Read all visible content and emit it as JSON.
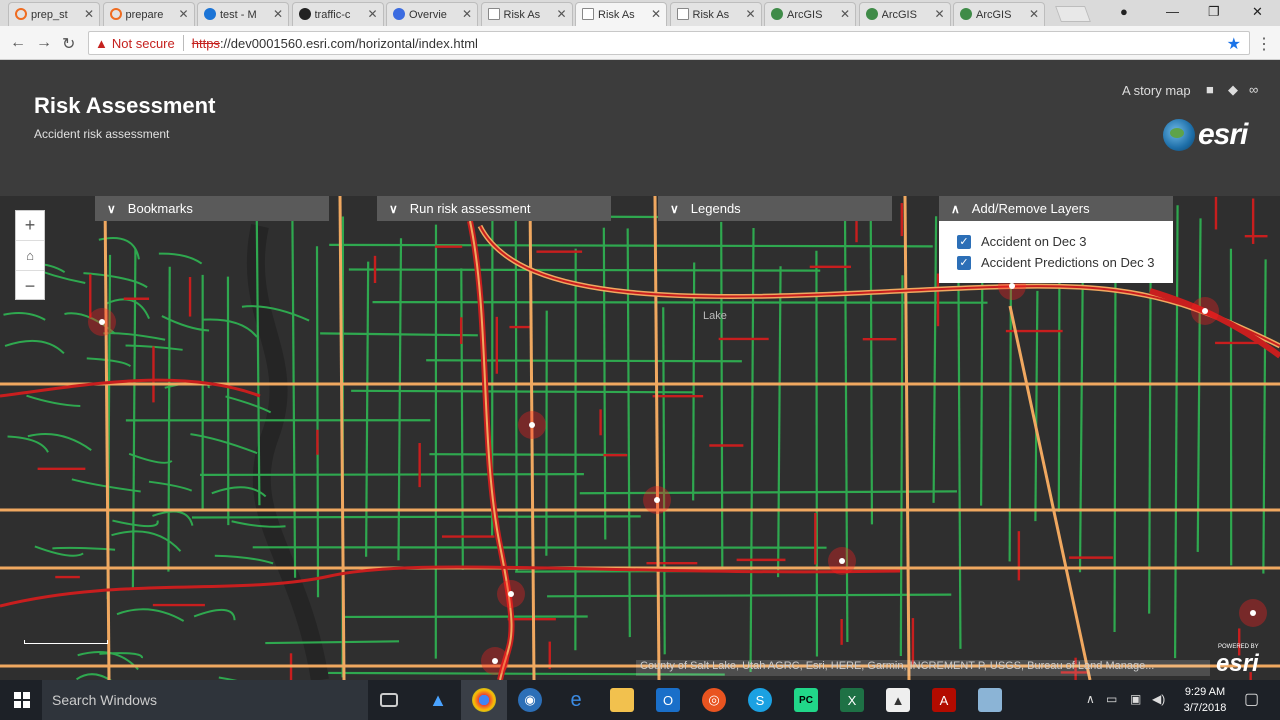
{
  "browser": {
    "tabs": [
      {
        "label": "prep_st",
        "icon": "circle-icon",
        "color": "#ef6c21"
      },
      {
        "label": "prepare",
        "icon": "circle-icon",
        "color": "#ef6c21"
      },
      {
        "label": "test - M",
        "icon": "azure-icon",
        "color": "#1b74d6"
      },
      {
        "label": "traffic-c",
        "icon": "github-icon",
        "color": "#222222"
      },
      {
        "label": "Overvie",
        "icon": "blue-circle-icon",
        "color": "#3b6be0"
      },
      {
        "label": "Risk As",
        "icon": "page-icon",
        "color": "#888888"
      },
      {
        "label": "Risk As",
        "icon": "page-icon",
        "color": "#888888"
      },
      {
        "label": "Risk As",
        "icon": "page-icon",
        "color": "#888888"
      },
      {
        "label": "ArcGIS",
        "icon": "globe-icon",
        "color": "#3f8b48"
      },
      {
        "label": "ArcGIS",
        "icon": "globe-icon",
        "color": "#3f8b48"
      },
      {
        "label": "ArcGIS",
        "icon": "globe-icon",
        "color": "#3f8b48"
      }
    ],
    "active_tab_index": 6,
    "security_label": "Not secure",
    "url_scheme": "https",
    "url_rest": "://dev0001560.esri.com/horizontal/index.html"
  },
  "header": {
    "title": "Risk Assessment",
    "subtitle": "Accident risk assessment",
    "story_map_label": "A story map",
    "logo_text": "esri"
  },
  "map": {
    "controls": {
      "zoom_in": "+",
      "home": "⌂",
      "zoom_out": "−"
    },
    "panels": {
      "bookmarks": "Bookmarks",
      "run_risk": "Run risk assessment",
      "legends": "Legends",
      "add_remove": "Add/Remove Layers"
    },
    "layers": [
      {
        "label": "Accident on Dec 3",
        "checked": true
      },
      {
        "label": "Accident Predictions on Dec 3",
        "checked": true
      }
    ],
    "place_label": "Lake",
    "attribution": "County of Salt Lake, Utah AGRC, Esri, HERE, Garmin, INCREMENT P, USGS, Bureau of Land Manage...",
    "powered_by": "POWERED BY",
    "powered_logo": "esri",
    "colors": {
      "green_road": "#2fa84f",
      "orange_road": "#f0a860",
      "red_road": "#c81e1e",
      "hotspot": "#ff2020"
    }
  },
  "taskbar": {
    "search_placeholder": "Search Windows",
    "time": "9:29 AM",
    "date": "3/7/2018"
  }
}
